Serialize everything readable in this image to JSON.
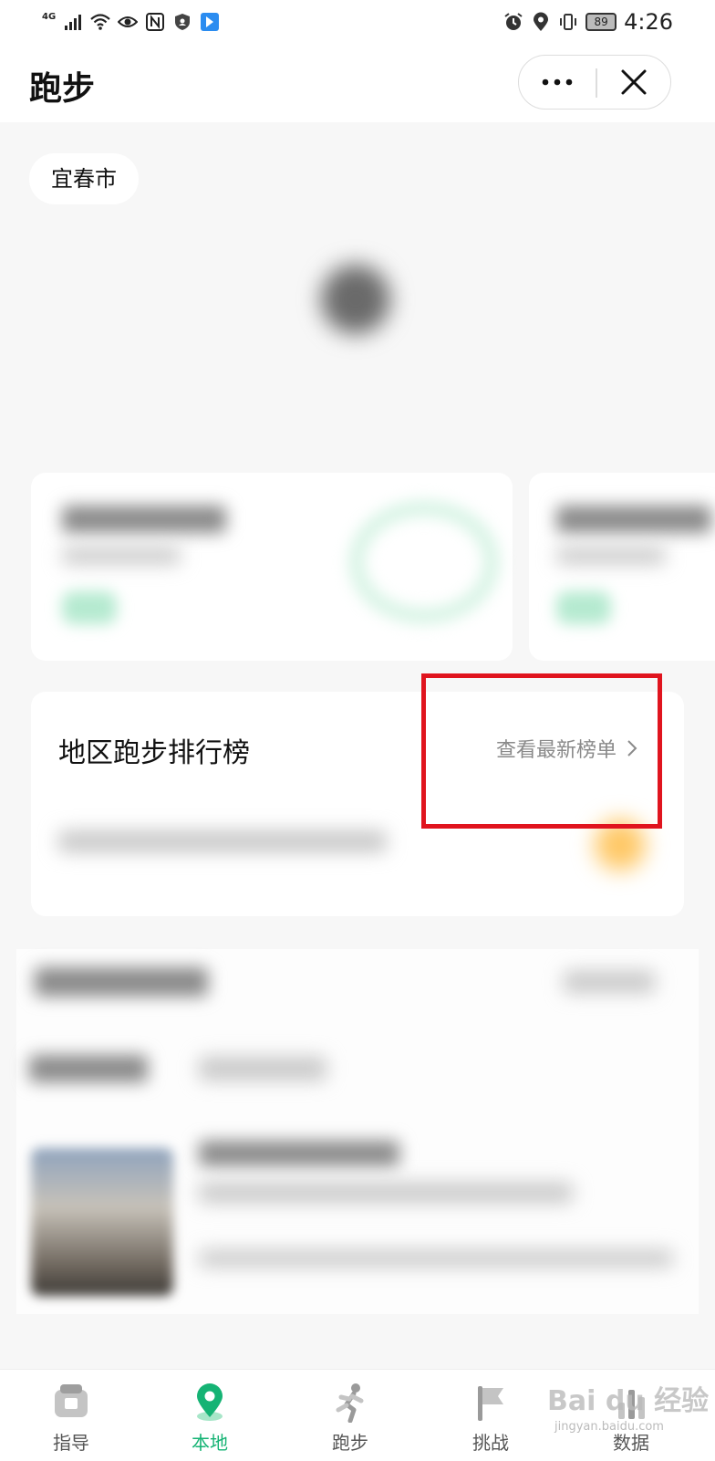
{
  "status_bar": {
    "network": "4G",
    "battery": "89",
    "time": "4:26",
    "icons_left": [
      "signal-icon",
      "wifi-icon",
      "eye-icon",
      "nfc-icon",
      "shield-icon",
      "app-notification-icon"
    ],
    "icons_right": [
      "alarm-icon",
      "location-icon",
      "vibrate-icon",
      "battery-icon"
    ]
  },
  "header": {
    "title": "跑步",
    "menu_icon": "more-dots-icon",
    "close_icon": "close-icon"
  },
  "main": {
    "city": "宜春市",
    "ranking": {
      "title": "地区跑步排行榜",
      "link_label": "查看最新榜单",
      "link_icon": "chevron-right-icon"
    },
    "highlight_color": "#e0141e"
  },
  "tabbar": {
    "active_color": "#15b374",
    "tabs": [
      {
        "label": "指导",
        "icon": "guide-icon",
        "active": false
      },
      {
        "label": "本地",
        "icon": "location-pin-icon",
        "active": true
      },
      {
        "label": "跑步",
        "icon": "runner-icon",
        "active": false
      },
      {
        "label": "挑战",
        "icon": "flag-icon",
        "active": false
      },
      {
        "label": "数据",
        "icon": "stats-icon",
        "active": false
      }
    ]
  },
  "watermark": {
    "text": "Bai du 经验",
    "url": "jingyan.baidu.com"
  }
}
